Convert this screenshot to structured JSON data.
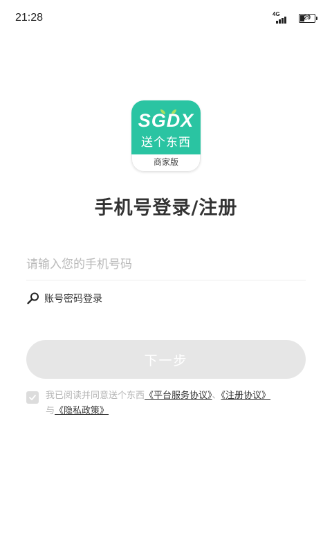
{
  "status_bar": {
    "time": "21:28",
    "network": "4G",
    "battery": "29"
  },
  "logo": {
    "brand": "SGDX",
    "chinese_name": "送个东西",
    "edition": "商家版"
  },
  "title": "手机号登录/注册",
  "phone_input": {
    "placeholder": "请输入您的手机号码",
    "value": ""
  },
  "password_login": {
    "label": "账号密码登录",
    "icon": "search-key-icon"
  },
  "next_button": {
    "label": "下一步"
  },
  "agreement": {
    "prefix": "我已阅读并同意送个东西",
    "platform_link": "《平台服务协议》",
    "separator": "、",
    "register_link": "《注册协议》",
    "and_text": "与",
    "privacy_link": "《隐私政策》"
  },
  "colors": {
    "brand_teal": "#2ac4a2",
    "leaf_green": "#a8e063",
    "button_disabled": "#e6e6e6",
    "placeholder": "#b9b9b9"
  }
}
